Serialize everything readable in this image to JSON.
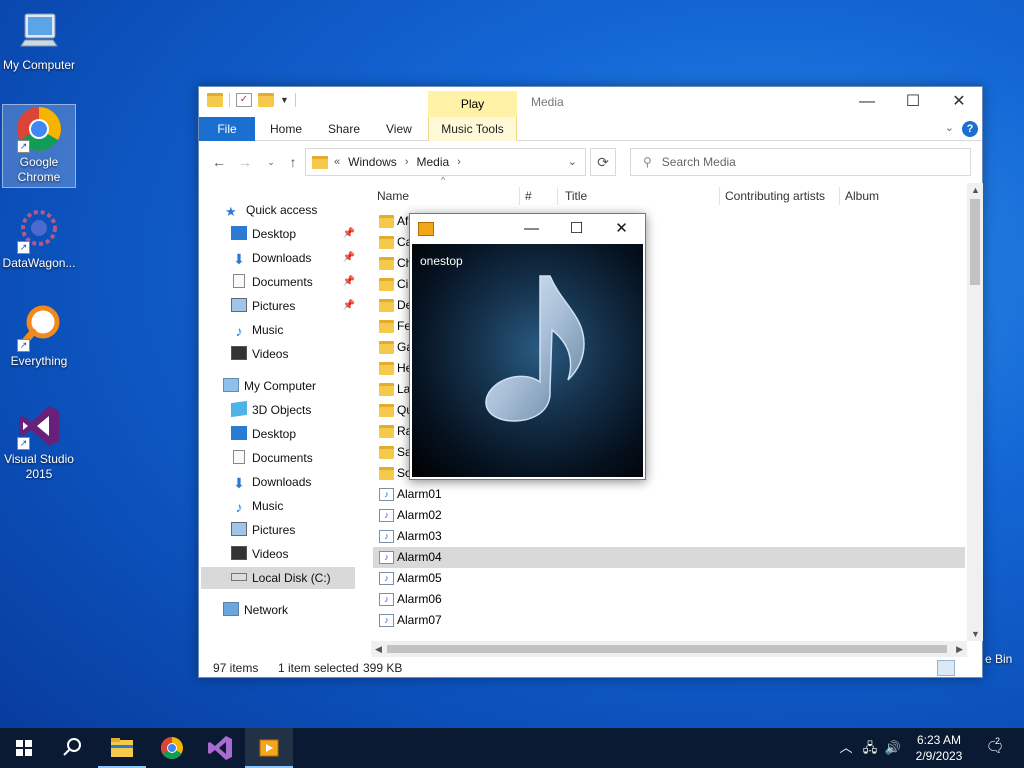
{
  "desktop": {
    "icons": [
      {
        "label": "My Computer"
      },
      {
        "label": "Google Chrome"
      },
      {
        "label": "DataWagon..."
      },
      {
        "label": "Everything"
      },
      {
        "label": "Visual Studio 2015"
      }
    ],
    "recycle_bin_partial": "e Bin"
  },
  "explorer": {
    "title": "Media",
    "context_tab": "Play",
    "tabs": [
      "File",
      "Home",
      "Share",
      "View",
      "Music Tools"
    ],
    "address": {
      "prefix": "«",
      "segments": [
        "Windows",
        "Media"
      ]
    },
    "search_placeholder": "Search Media",
    "nav": {
      "quick_access": "Quick access",
      "quick_items": [
        "Desktop",
        "Downloads",
        "Documents",
        "Pictures",
        "Music",
        "Videos"
      ],
      "my_computer": "My Computer",
      "pc_items": [
        "3D Objects",
        "Desktop",
        "Documents",
        "Downloads",
        "Music",
        "Pictures",
        "Videos",
        "Local Disk (C:)"
      ],
      "network": "Network"
    },
    "columns": [
      "Name",
      "#",
      "Title",
      "Contributing artists",
      "Album"
    ],
    "folders": [
      "Af",
      "Ca",
      "Ch",
      "Ci",
      "De",
      "Fe",
      "Ga",
      "He",
      "La",
      "Qu",
      "Ra",
      "Sa",
      "So"
    ],
    "files": [
      "Alarm01",
      "Alarm02",
      "Alarm03",
      "Alarm04",
      "Alarm05",
      "Alarm06",
      "Alarm07"
    ],
    "selected_file": "Alarm04",
    "status": {
      "items": "97 items",
      "selected": "1 item selected",
      "size": "399 KB"
    }
  },
  "player": {
    "track": "onestop"
  },
  "taskbar": {
    "time": "6:23 AM",
    "date": "2/9/2023",
    "notification_count": "2"
  }
}
